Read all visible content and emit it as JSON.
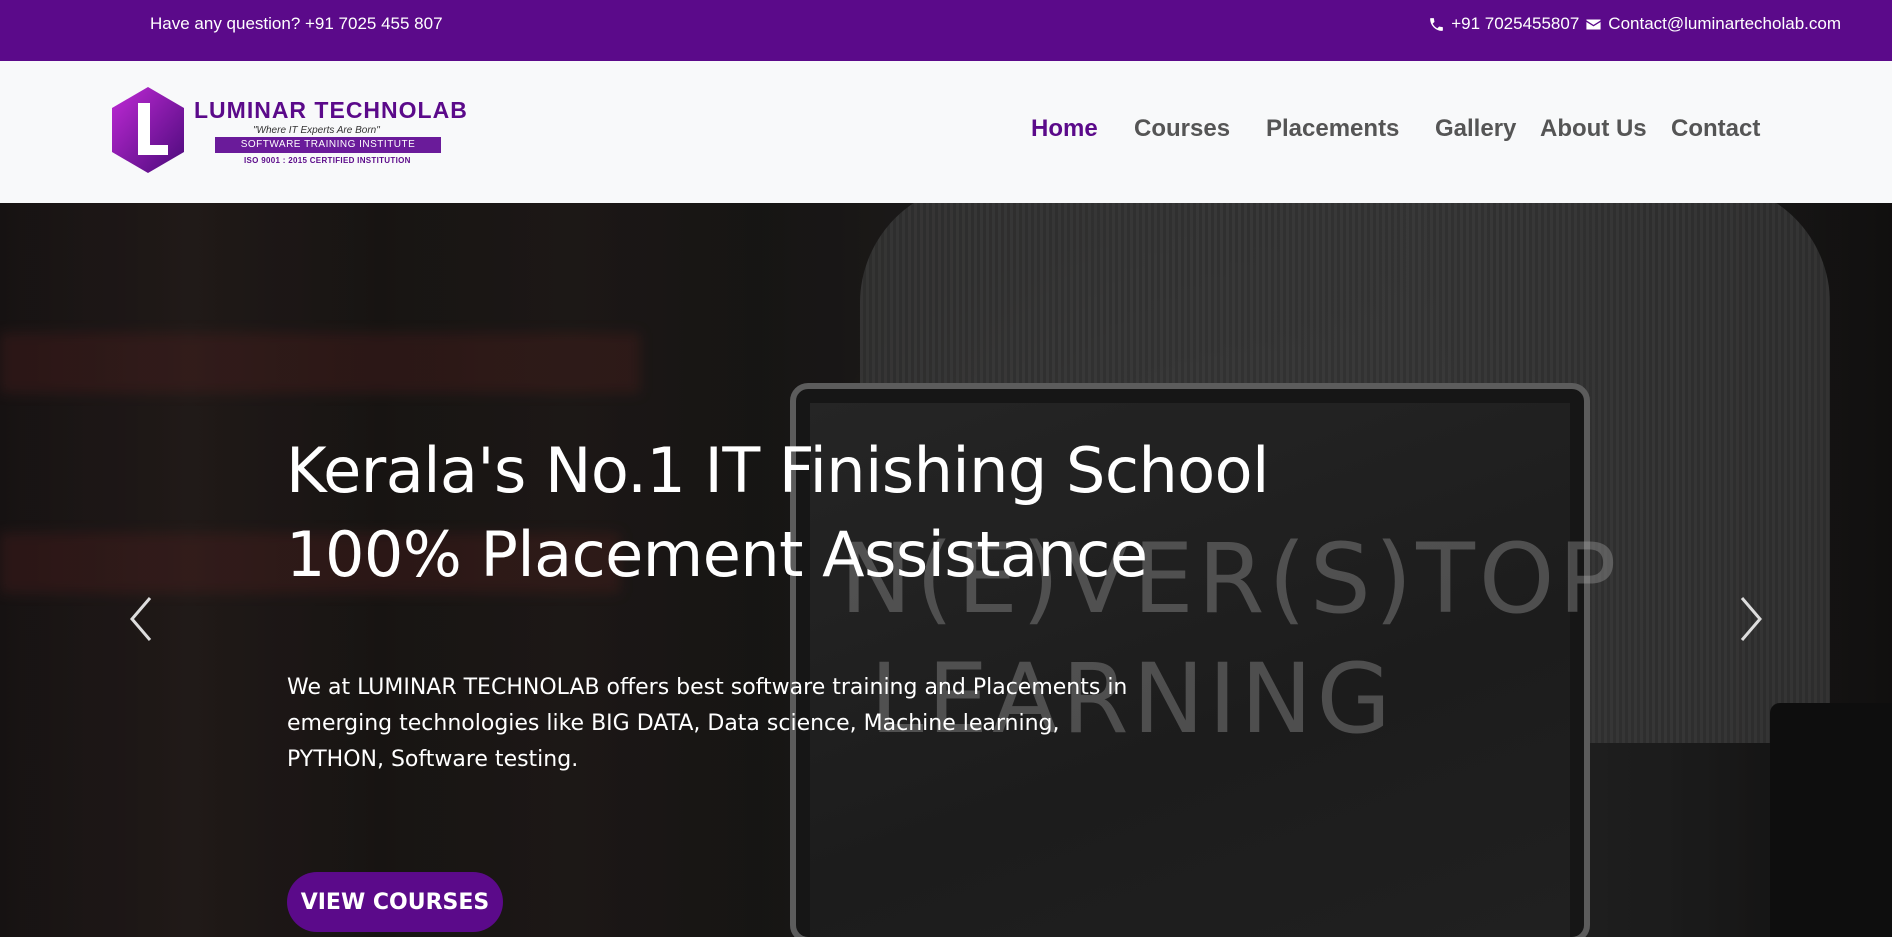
{
  "topbar": {
    "question": "Have any question? +91 7025 455 807",
    "phone": "+91 7025455807",
    "email": "Contact@luminartecholab.com"
  },
  "logo": {
    "name": "LUMINAR TECHNOLAB",
    "tagline": "\"Where IT Experts Are Born\"",
    "subtitle": "SOFTWARE TRAINING INSTITUTE",
    "iso": "ISO 9001 : 2015 CERTIFIED INSTITUTION"
  },
  "nav": {
    "items": [
      {
        "label": "Home",
        "active": true
      },
      {
        "label": "Courses",
        "active": false
      },
      {
        "label": "Placements",
        "active": false
      },
      {
        "label": "Gallery",
        "active": false
      },
      {
        "label": "About Us",
        "active": false
      },
      {
        "label": "Contact",
        "active": false
      }
    ]
  },
  "hero": {
    "title_line1": "Kerala's No.1 IT Finishing School",
    "title_line2": "100% Placement Assistance",
    "description": "We at LUMINAR TECHNOLAB offers best software training and Placements in emerging technologies like BIG DATA, Data science, Machine learning, PYTHON, Software testing.",
    "cta_label": "VIEW COURSES",
    "chalk_line1": "N(E)VER(S)TOP",
    "chalk_line2": "LEARNING"
  },
  "colors": {
    "brand": "#5b0a8a",
    "nav_text": "#555555",
    "header_bg": "#f8f9fa"
  },
  "icons": {
    "phone": "phone-icon",
    "email": "envelope-icon",
    "prev": "chevron-left-icon",
    "next": "chevron-right-icon"
  }
}
